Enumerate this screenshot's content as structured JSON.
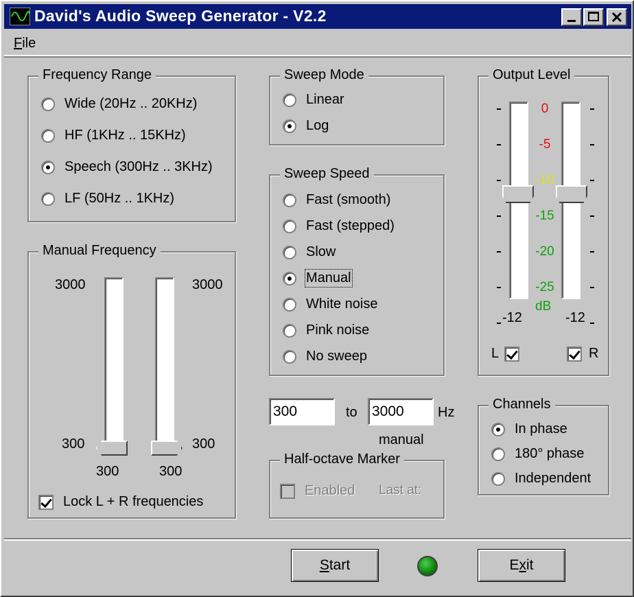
{
  "window": {
    "title": "David's Audio Sweep Generator - V2.2"
  },
  "menu": {
    "file_prefix": "F",
    "file_rest": "ile"
  },
  "frequency_range": {
    "title": "Frequency Range",
    "options": [
      {
        "label": "Wide  (20Hz .. 20KHz)",
        "selected": false
      },
      {
        "label": "HF  (1KHz .. 15KHz)",
        "selected": false
      },
      {
        "label": "Speech  (300Hz .. 3KHz)",
        "selected": true
      },
      {
        "label": "LF  (50Hz .. 1KHz)",
        "selected": false
      }
    ]
  },
  "manual_frequency": {
    "title": "Manual Frequency",
    "left_top": "3000",
    "right_top": "3000",
    "left_bottom": "300",
    "right_bottom": "300",
    "left_value": "300",
    "right_value": "300",
    "lock_label": "Lock L + R frequencies",
    "lock_checked": true
  },
  "sweep_mode": {
    "title": "Sweep Mode",
    "options": [
      {
        "label": "Linear",
        "selected": false
      },
      {
        "label": "Log",
        "selected": true
      }
    ]
  },
  "sweep_speed": {
    "title": "Sweep Speed",
    "options": [
      {
        "label": "Fast (smooth)",
        "selected": false
      },
      {
        "label": "Fast (stepped)",
        "selected": false
      },
      {
        "label": "Slow",
        "selected": false
      },
      {
        "label": "Manual",
        "selected": true
      },
      {
        "label": "White noise",
        "selected": false
      },
      {
        "label": "Pink noise",
        "selected": false
      },
      {
        "label": "No sweep",
        "selected": false
      }
    ]
  },
  "range_inputs": {
    "from": "300",
    "to_label": "to",
    "to": "3000",
    "unit": "Hz",
    "caption": "manual"
  },
  "half_octave": {
    "title": "Half-octave Marker",
    "enabled_label": "Enabled",
    "last_at_label": "Last at:"
  },
  "output_level": {
    "title": "Output Level",
    "scale": [
      {
        "label": "0",
        "color": "#e01010"
      },
      {
        "label": "-5",
        "color": "#e01010"
      },
      {
        "label": "-10",
        "color": "#e0e020"
      },
      {
        "label": "-15",
        "color": "#10a010"
      },
      {
        "label": "-20",
        "color": "#10a010"
      },
      {
        "label": "-25",
        "color": "#10a010"
      }
    ],
    "unit": "dB",
    "unit_color": "#10a010",
    "left_value": "-12",
    "right_value": "-12",
    "left_label": "L",
    "right_label": "R",
    "left_checked": true,
    "right_checked": true
  },
  "channels": {
    "title": "Channels",
    "options": [
      {
        "label": "In phase",
        "selected": true
      },
      {
        "label": "180° phase",
        "selected": false
      },
      {
        "label": "Independent",
        "selected": false
      }
    ]
  },
  "buttons": {
    "start_prefix": "S",
    "start_rest": "tart",
    "exit_pre": "E",
    "exit_mid": "x",
    "exit_post": "it"
  },
  "colors": {
    "titlebar": "#0a1a78",
    "face": "#c6c6c6",
    "led": "#118811"
  }
}
